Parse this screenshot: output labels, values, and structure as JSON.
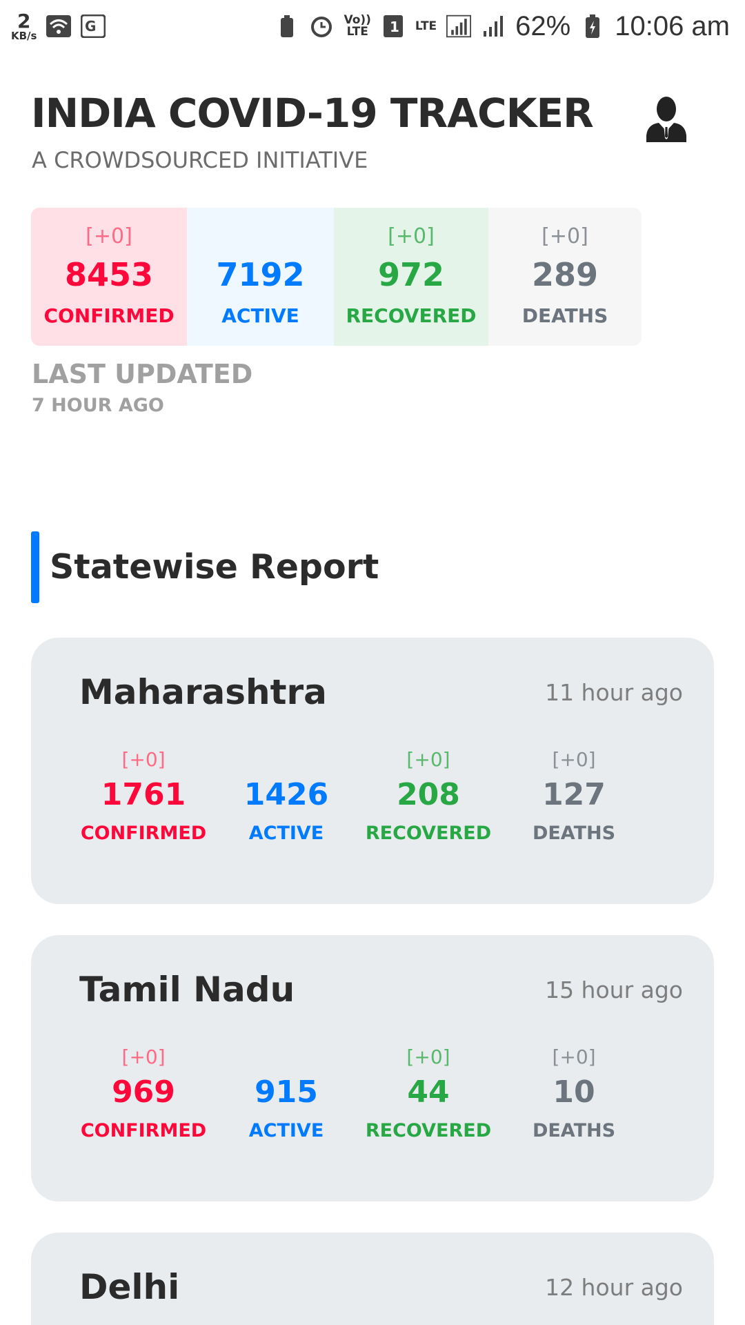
{
  "status_bar": {
    "net_speed": "2",
    "net_unit": "KB/s",
    "volte": [
      "Vo))",
      "LTE"
    ],
    "sim": "1",
    "lte": "LTE",
    "battery": "62%",
    "time": "10:06 am"
  },
  "header": {
    "title": "INDIA COVID-19 TRACKER",
    "subtitle": "A CROWDSOURCED INITIATIVE"
  },
  "summary": {
    "confirmed": {
      "delta": "[+0]",
      "value": "8453",
      "label": "CONFIRMED"
    },
    "active": {
      "delta": "",
      "value": "7192",
      "label": "ACTIVE"
    },
    "recovered": {
      "delta": "[+0]",
      "value": "972",
      "label": "RECOVERED"
    },
    "deaths": {
      "delta": "[+0]",
      "value": "289",
      "label": "DEATHS"
    }
  },
  "last_updated": {
    "label": "LAST UPDATED",
    "time": "7 HOUR AGO"
  },
  "section_title": "Statewise Report",
  "states": [
    {
      "name": "Maharashtra",
      "time": "11 hour ago",
      "confirmed": {
        "delta": "[+0]",
        "value": "1761",
        "label": "CONFIRMED"
      },
      "active": {
        "delta": "",
        "value": "1426",
        "label": "ACTIVE"
      },
      "recovered": {
        "delta": "[+0]",
        "value": "208",
        "label": "RECOVERED"
      },
      "deaths": {
        "delta": "[+0]",
        "value": "127",
        "label": "DEATHS"
      }
    },
    {
      "name": "Tamil Nadu",
      "time": "15 hour ago",
      "confirmed": {
        "delta": "[+0]",
        "value": "969",
        "label": "CONFIRMED"
      },
      "active": {
        "delta": "",
        "value": "915",
        "label": "ACTIVE"
      },
      "recovered": {
        "delta": "[+0]",
        "value": "44",
        "label": "RECOVERED"
      },
      "deaths": {
        "delta": "[+0]",
        "value": "10",
        "label": "DEATHS"
      }
    },
    {
      "name": "Delhi",
      "time": "12 hour ago"
    }
  ],
  "icons": {
    "wifi": "wifi-icon",
    "translate": "translate-icon",
    "alarm": "alarm-icon",
    "signal": "signal-icon",
    "battery": "battery-charging-icon",
    "profile": "user-profile-icon"
  },
  "colors": {
    "confirmed": "#ff073a",
    "active": "#007bff",
    "recovered": "#28a745",
    "deaths": "#6c757d",
    "accent": "#007bff"
  }
}
